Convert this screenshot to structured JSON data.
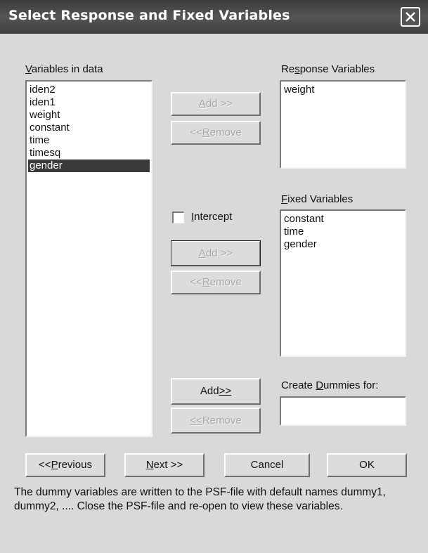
{
  "window": {
    "title": "Select Response and Fixed Variables"
  },
  "variables_panel": {
    "label_prefix": "V",
    "label_rest": "ariables in data",
    "items": [
      "iden2",
      "iden1",
      "weight",
      "constant",
      "time",
      "timesq",
      "gender"
    ],
    "selected": "gender"
  },
  "response_panel": {
    "label_pre": "Re",
    "label_key": "s",
    "label_post": "ponse Variables",
    "items": [
      "weight"
    ]
  },
  "fixed_panel": {
    "label_key": "F",
    "label_post": "ixed Variables",
    "items": [
      "constant",
      "time",
      "gender"
    ]
  },
  "dummies_panel": {
    "label_pre": "Create ",
    "label_key": "D",
    "label_post": "ummies for:",
    "value": ""
  },
  "intercept": {
    "label_key": "I",
    "label_post": "ntercept",
    "checked": false
  },
  "buttons": {
    "response_add": {
      "pre": "",
      "key": "A",
      "post": "dd >>"
    },
    "response_remove": {
      "pre": "<< ",
      "key": "R",
      "post": "emove"
    },
    "fixed_add": {
      "pre": "",
      "key": "A",
      "post": "dd >>"
    },
    "fixed_remove": {
      "pre": "<< ",
      "key": "R",
      "post": "emove"
    },
    "dummies_add": {
      "pre": "Add ",
      "key": ">>",
      "post": ""
    },
    "dummies_remove": {
      "pre": "",
      "key": "<<",
      "post": " Remove"
    },
    "previous": {
      "pre": "<< ",
      "key": "P",
      "post": "revious"
    },
    "next": {
      "pre": "",
      "key": "N",
      "post": "ext >>"
    },
    "cancel": "Cancel",
    "ok": "OK"
  },
  "footer": {
    "note": "The dummy variables are written to the PSF-file with default names dummy1, dummy2, .... Close the PSF-file and re-open to view these variables."
  },
  "colors": {
    "dialog_bg": "#d9d9d9",
    "titlebar": "#4a4a4a",
    "selection": "#3a3a3a"
  }
}
